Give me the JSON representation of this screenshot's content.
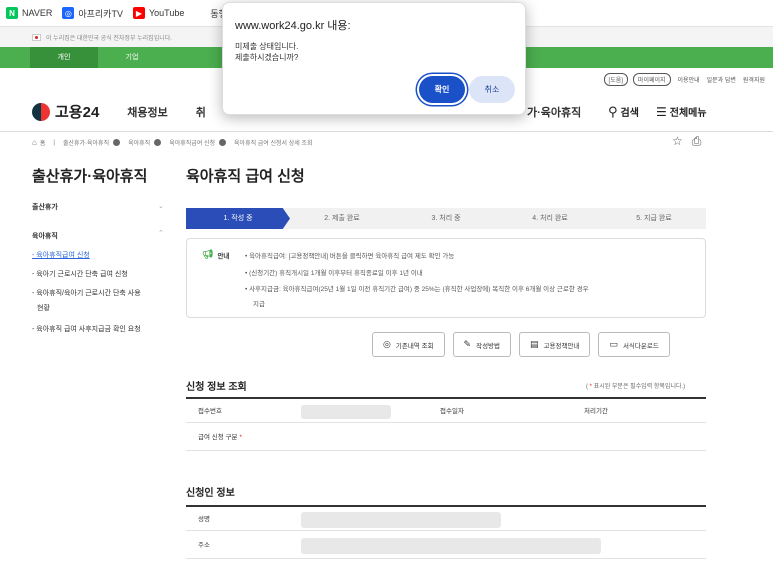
{
  "bookmarks": [
    {
      "label": "NAVER",
      "icon": "naver-icon"
    },
    {
      "label": "아프리카TV",
      "icon": "afreecatv-icon"
    },
    {
      "label": "YouTube",
      "icon": "youtube-icon"
    },
    {
      "label": "동행복",
      "icon": "lottery-icon"
    }
  ],
  "gov_notice": "이 누리집은 대한민국 공식 전자정부 누리집입니다.",
  "audience_tabs": [
    "개인",
    "기업"
  ],
  "util_links": {
    "pill1": "[도움]",
    "pill2": "마이페이지",
    "link1": "이용안내",
    "link2": "일문과 답변",
    "link3": "원격지원"
  },
  "header": {
    "logo_text": "고용24",
    "nav_primary": "채용정보",
    "nav_primary_partial": "취",
    "nav_current": "가·육아휴직",
    "search_label": "검색",
    "menu_label": "전체메뉴"
  },
  "breadcrumb": [
    "홈",
    "출산휴가·육아휴직",
    "육아휴직",
    "육아휴직급여 신청",
    "육아휴직 급여 신청서 상세 조회"
  ],
  "sidebar": {
    "title": "출산휴가·육아휴직",
    "group1": "출산휴가",
    "group2": "육아휴직",
    "items": [
      "- 육아휴직급여 신청",
      "- 육아기 근로시간 단축 급여 신청",
      "- 육아휴직/육아기 근로시간 단축 사용",
      "현황",
      "- 육아휴직 급여 사후지급금 확인 요청"
    ]
  },
  "main": {
    "title": "육아휴직 급여 신청",
    "steps": [
      "1. 작성 중",
      "2. 제출 완료",
      "3. 처리 중",
      "4. 처리 완료",
      "5. 지급 완료"
    ],
    "info_label": "안내",
    "info_lines": [
      "•  육아휴직급여: [고용정책안내] 버튼을 클릭하면 육아휴직 급여 제도 확인 가능",
      "•  (신청기간) 휴직개시일 1개월 이후부터 휴직종료일 이후 1년 이내",
      "•  사후지급금: 육아휴직급여(25년 1월 1일 이전 휴직기간 급여) 중 25%는 (휴직한 사업장에) 복직한 이후 6개월 이상 근로한 경우",
      "지급"
    ],
    "buttons": [
      "기존내역 조회",
      "작성방법",
      "고용정책안내",
      "서식다운로드"
    ],
    "section1_title": "신청 정보 조회",
    "required_note_prefix": "(",
    "required_note_star": "*",
    "required_note_text": "표시된 부분은 필수입력 항목입니다.)",
    "table1": {
      "col1": "접수번호",
      "col2": "접수일자",
      "col3": "처리기간",
      "row2_label": "급여 신청 구분",
      "row2_star": "*"
    },
    "section2_title": "신청인 정보",
    "table2": {
      "row1": "성명",
      "row2": "주소"
    }
  },
  "dialog": {
    "title": "www.work24.go.kr 내용:",
    "line1": "미제출 상태입니다.",
    "line2": "제출하시겠습니까?",
    "ok": "확인",
    "cancel": "취소",
    "ok_color": "#1a50c8"
  }
}
